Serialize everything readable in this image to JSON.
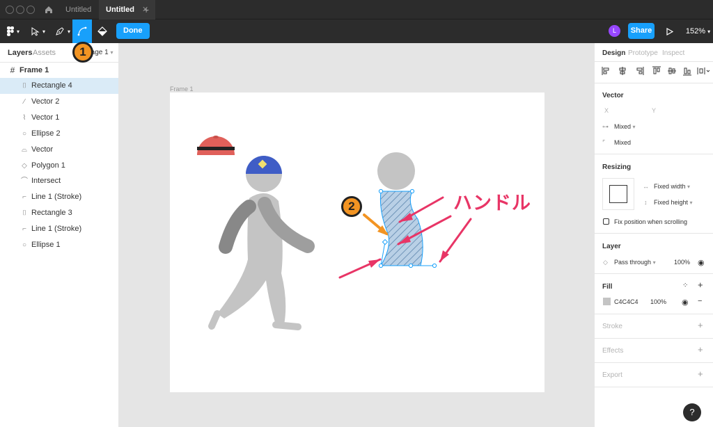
{
  "tabs": [
    {
      "label": "Untitled",
      "active": false
    },
    {
      "label": "Untitled",
      "active": true
    }
  ],
  "toolbar": {
    "done_label": "Done",
    "share_label": "Share",
    "avatar_initial": "L",
    "zoom": "152%"
  },
  "left_panel": {
    "tabs": [
      "Layers",
      "Assets"
    ],
    "page_label": "Page 1",
    "frame_name": "Frame 1",
    "layers": [
      {
        "name": "Rectangle 4",
        "icon": "path-icon",
        "glyph": "⌷",
        "selected": true
      },
      {
        "name": "Vector 2",
        "icon": "vector-icon",
        "glyph": "⁄",
        "selected": false
      },
      {
        "name": "Vector 1",
        "icon": "vector-icon",
        "glyph": "⌇",
        "selected": false
      },
      {
        "name": "Ellipse 2",
        "icon": "ellipse-icon",
        "glyph": "○",
        "selected": false
      },
      {
        "name": "Vector",
        "icon": "vector-icon",
        "glyph": "⌓",
        "selected": false
      },
      {
        "name": "Polygon 1",
        "icon": "polygon-icon",
        "glyph": "◇",
        "selected": false
      },
      {
        "name": "Intersect",
        "icon": "boolean-icon",
        "glyph": "⌒",
        "selected": false
      },
      {
        "name": "Line 1 (Stroke)",
        "icon": "stroke-icon",
        "glyph": "⌐",
        "selected": false
      },
      {
        "name": "Rectangle 3",
        "icon": "path-icon",
        "glyph": "⌷",
        "selected": false
      },
      {
        "name": "Line 1 (Stroke)",
        "icon": "stroke-icon",
        "glyph": "⌐",
        "selected": false
      },
      {
        "name": "Ellipse 1",
        "icon": "ellipse-icon",
        "glyph": "○",
        "selected": false
      }
    ]
  },
  "canvas": {
    "frame_label": "Frame 1",
    "annotation": "ハンドル",
    "badge_1": "1",
    "badge_2": "2"
  },
  "right_panel": {
    "tabs": [
      "Design",
      "Prototype",
      "Inspect"
    ],
    "vector": {
      "title": "Vector",
      "x_label": "X",
      "y_label": "Y",
      "corner_mixed": "Mixed",
      "radius_mixed": "Mixed"
    },
    "resizing": {
      "title": "Resizing",
      "width_mode": "Fixed width",
      "height_mode": "Fixed height",
      "fix_position": "Fix position when scrolling"
    },
    "layer": {
      "title": "Layer",
      "blend": "Pass through",
      "opacity": "100%"
    },
    "fill": {
      "title": "Fill",
      "hex": "C4C4C4",
      "opacity": "100%",
      "color": "#c4c4c4"
    },
    "stroke_title": "Stroke",
    "effects_title": "Effects",
    "export_title": "Export"
  },
  "help_label": "?",
  "colors": {
    "accent": "#18a0fb",
    "annotation": "#e83566",
    "badge": "#f29423"
  }
}
